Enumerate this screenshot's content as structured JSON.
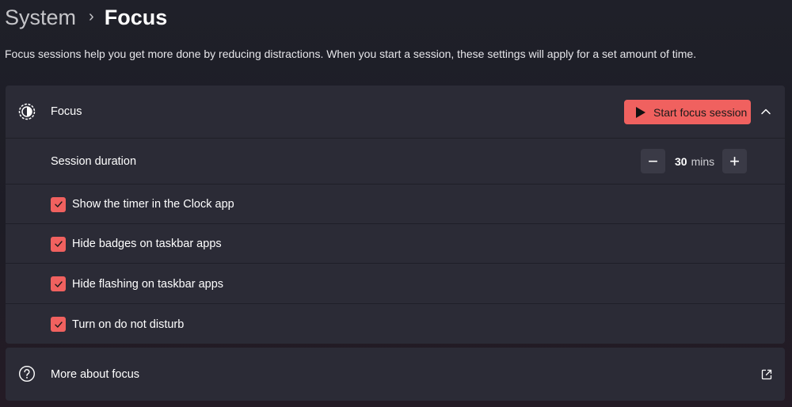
{
  "breadcrumb": {
    "parent": "System",
    "separator": "›",
    "current": "Focus"
  },
  "description": "Focus sessions help you get more done by reducing distractions. When you start a session, these settings will apply for a set amount of time.",
  "focus_card": {
    "icon": "focus-icon",
    "title": "Focus",
    "start_button_label": "Start focus session",
    "start_button_icon": "play-icon",
    "expanded": true,
    "accent_color": "#f0615f"
  },
  "duration": {
    "label": "Session duration",
    "minus_symbol": "−",
    "plus_symbol": "+",
    "value": "30",
    "unit": "mins"
  },
  "options": [
    {
      "label": "Show the timer in the Clock app",
      "checked": true
    },
    {
      "label": "Hide badges on taskbar apps",
      "checked": true
    },
    {
      "label": "Hide flashing on taskbar apps",
      "checked": true
    },
    {
      "label": "Turn on do not disturb",
      "checked": true
    }
  ],
  "more": {
    "icon": "help-icon",
    "label": "More about focus",
    "link_icon": "external-link-icon"
  }
}
